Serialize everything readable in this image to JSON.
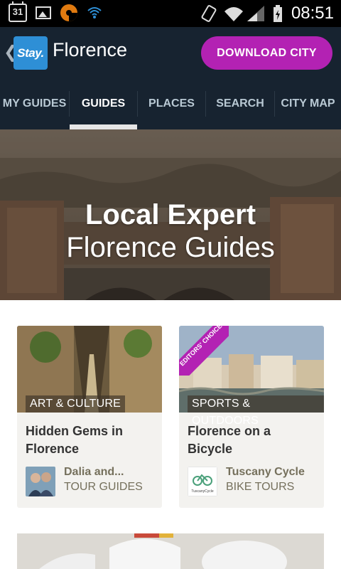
{
  "status_bar": {
    "calendar_day": "31",
    "time": "08:51",
    "icons": [
      "calendar-icon",
      "image-icon",
      "app-icon",
      "wifi-icon",
      "rotate-icon",
      "signal-icon",
      "battery-icon"
    ]
  },
  "header": {
    "back_glyph": "❮",
    "logo_text": "Stay.",
    "city": "Florence",
    "download_label": "DOWNLOAD CITY"
  },
  "tabs": [
    {
      "label": "MY GUIDES",
      "active": false
    },
    {
      "label": "GUIDES",
      "active": true
    },
    {
      "label": "PLACES",
      "active": false
    },
    {
      "label": "SEARCH",
      "active": false
    },
    {
      "label": "CITY MAP",
      "active": false
    }
  ],
  "hero": {
    "line1": "Local Expert",
    "line2": "Florence Guides"
  },
  "guides": [
    {
      "category": "ART & CULTURE",
      "title": "Hidden Gems in Florence",
      "author": "Dalia and...",
      "role": "TOUR GUIDES"
    },
    {
      "category": "SPORTS & OUTDOORS",
      "badge": "EDITORS' CHOICE",
      "title": "Florence on a Bicycle",
      "author": "Tuscany Cycle",
      "role": "BIKE TOURS",
      "logo_text": "TuscanyCycle"
    }
  ],
  "colors": {
    "accent": "#b322b3",
    "header_bg": "#172330",
    "logo_blue": "#2e8fd6",
    "card_bg": "#f3f2ef"
  }
}
